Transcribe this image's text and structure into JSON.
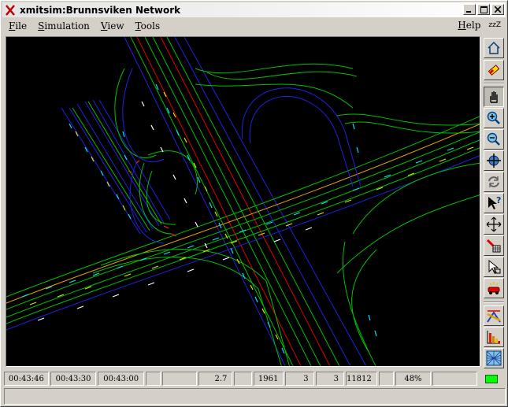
{
  "window": {
    "title": "xmitsim:Brunnsviken Network"
  },
  "menu": {
    "file": "File",
    "simulation": "Simulation",
    "view": "View",
    "tools": "Tools",
    "help": "Help",
    "sleep": "zzZ"
  },
  "toolbar": {
    "icons": [
      "home-icon",
      "eraser-icon",
      "hand-icon",
      "zoom-in-icon",
      "zoom-out-icon",
      "crosshair-icon",
      "refresh-icon",
      "query-pointer-icon",
      "move-icon",
      "grid-edit-icon",
      "select-pointer-icon",
      "vehicle-icon",
      "path-icon",
      "histogram-icon",
      "network-icon"
    ]
  },
  "status": {
    "time_current": "00:43:46",
    "time_2": "00:43:30",
    "time_3": "00:43:00",
    "blank": "",
    "rate": "2.7",
    "vehicles": "1961",
    "val_a": "3",
    "val_b": "3",
    "count": "11812",
    "zoom": "48%"
  },
  "colors": {
    "road_green": "#00c000",
    "road_blue": "#2020e0",
    "road_red": "#e00000",
    "road_yellow": "#e0e000",
    "vehicle_cyan": "#00e0ff",
    "indicator": "#00ff00"
  }
}
